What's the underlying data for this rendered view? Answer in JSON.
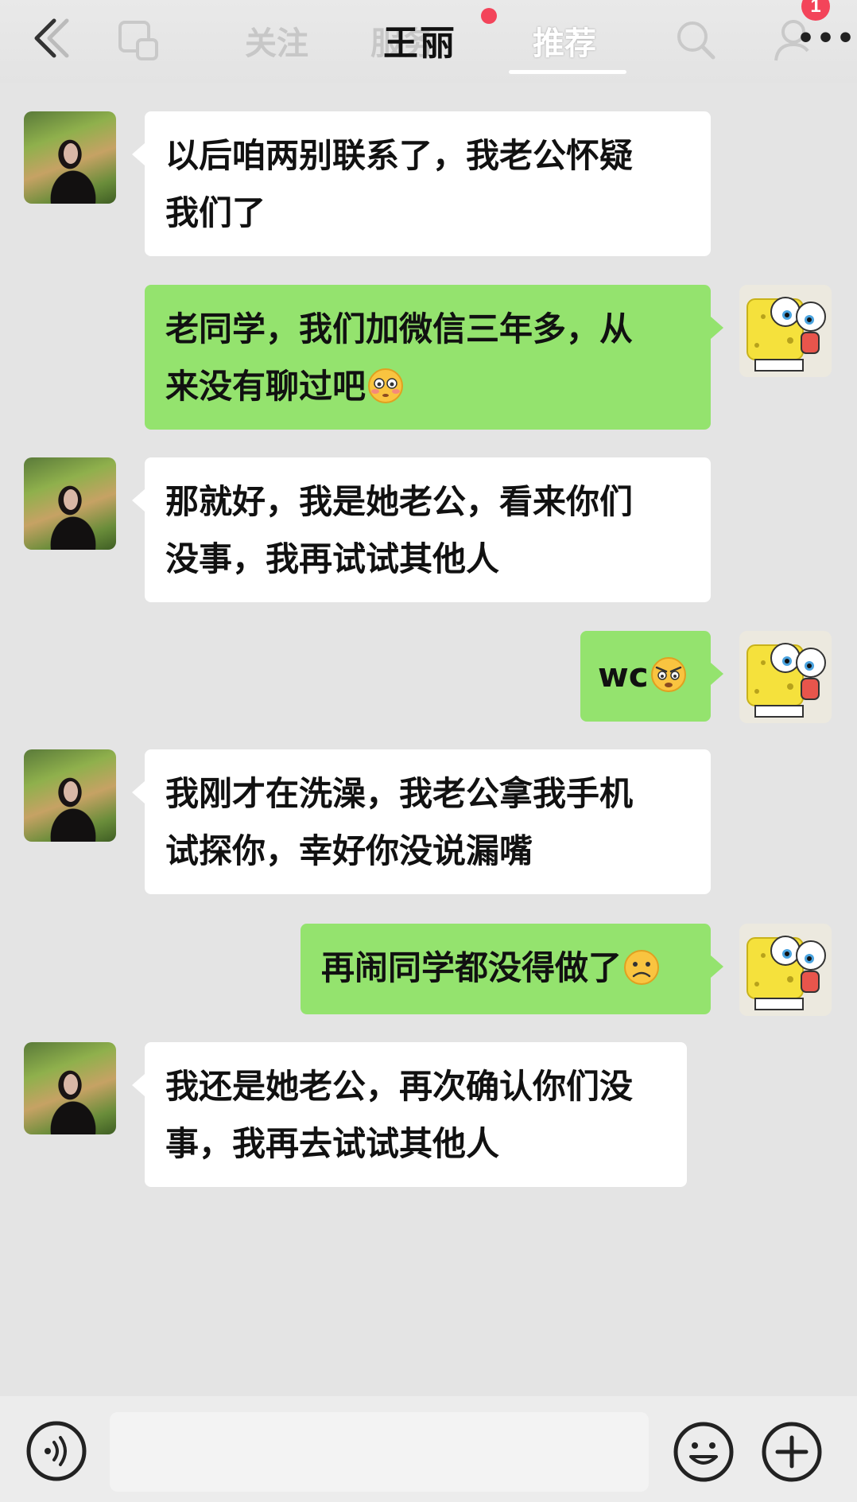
{
  "header": {
    "tabs": [
      {
        "label": "关注"
      },
      {
        "label": "服务"
      },
      {
        "label": "推荐"
      }
    ],
    "chat_title": "王丽",
    "notification_badge": "1",
    "more_label": "•••"
  },
  "messages": [
    {
      "side": "left",
      "lines": [
        "以后咱两别联系了，我老公怀疑",
        "我们了"
      ]
    },
    {
      "side": "right",
      "lines": [
        "老同学，我们加微信三年多，从",
        "来没有聊过吧"
      ],
      "emoji": "flushed-emoji"
    },
    {
      "side": "left",
      "lines": [
        "那就好，我是她老公，看来你们",
        "没事，我再试试其他人"
      ]
    },
    {
      "side": "right",
      "lines": [
        "wc"
      ],
      "emoji": "angry-emoji"
    },
    {
      "side": "left",
      "lines": [
        "我刚才在洗澡，我老公拿我手机",
        "试探你，幸好你没说漏嘴"
      ]
    },
    {
      "side": "right",
      "lines": [
        "再闹同学都没得做了"
      ],
      "emoji": "frowning-emoji"
    },
    {
      "side": "left",
      "lines": [
        "我还是她老公，再次确认你们没",
        "事，我再去试试其他人"
      ]
    }
  ],
  "input": {
    "value": "",
    "placeholder": ""
  },
  "colors": {
    "background": "#e4e4e4",
    "incoming_bubble": "#ffffff",
    "outgoing_bubble": "#94e36e",
    "notification_red": "#f3445a"
  },
  "icons": [
    "back-icon",
    "window-icon",
    "search-icon",
    "profile-icon",
    "voice-icon",
    "smiley-icon",
    "plus-icon"
  ]
}
